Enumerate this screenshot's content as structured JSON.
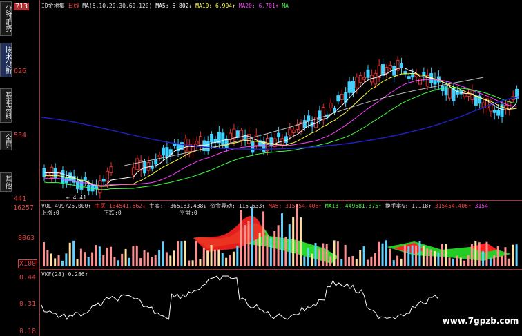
{
  "sidebar": {
    "tabs": [
      {
        "label": "分时走势"
      },
      {
        "label": "技术分析"
      },
      {
        "label": "基本资料"
      },
      {
        "label": "全屏"
      },
      {
        "label": "其他"
      }
    ]
  },
  "price_panel": {
    "y_labels": [
      "713",
      "626",
      "534",
      "441"
    ],
    "header": {
      "code": "ID金地集",
      "period": "日线",
      "ma_def": "MA(5,10,20,30,60,120)",
      "ma5": "MA5: 6.802↓",
      "ma10": "MA10: 6.904↑",
      "ma20": "MA20: 6.701↑",
      "ma_more": "MA"
    },
    "low_label": "4.41",
    "colors": {
      "up": "#e03030",
      "down": "#40d0ff",
      "ma5": "#ffffff",
      "ma10": "#ffff40",
      "ma20": "#ff40ff",
      "ma30": "#40ff40",
      "ma60": "#c0c0c0",
      "ma120": "#2020c0"
    }
  },
  "volume_panel": {
    "y_labels": [
      "16257",
      "8063",
      "X100"
    ],
    "header": {
      "vol": "VOL 499725.000↑",
      "main_net_label": "主买",
      "main_net_value": "134541.562↓",
      "main_label": "主卖:",
      "main_value": "-365183.438↓",
      "fund_label": "资金异动:",
      "fund_value": "115.633↑",
      "ma5": "MA5: 315454.406↑",
      "ma13": "MA13: 449581.375↑",
      "turnover_label": "换手率%:",
      "turnover_value": "1.118↑",
      "extra": "315454.406↑",
      "extra2": "3154"
    },
    "sub_labels": {
      "up": "上涨:0",
      "down": "下跌:0",
      "flat": "平盘:0"
    }
  },
  "indicator_panel": {
    "y_labels": [
      "0.44",
      "0.31",
      "0.18"
    ],
    "header": "VKF(28)    0.286↑"
  },
  "watermark": "www.7gpzb.com"
}
